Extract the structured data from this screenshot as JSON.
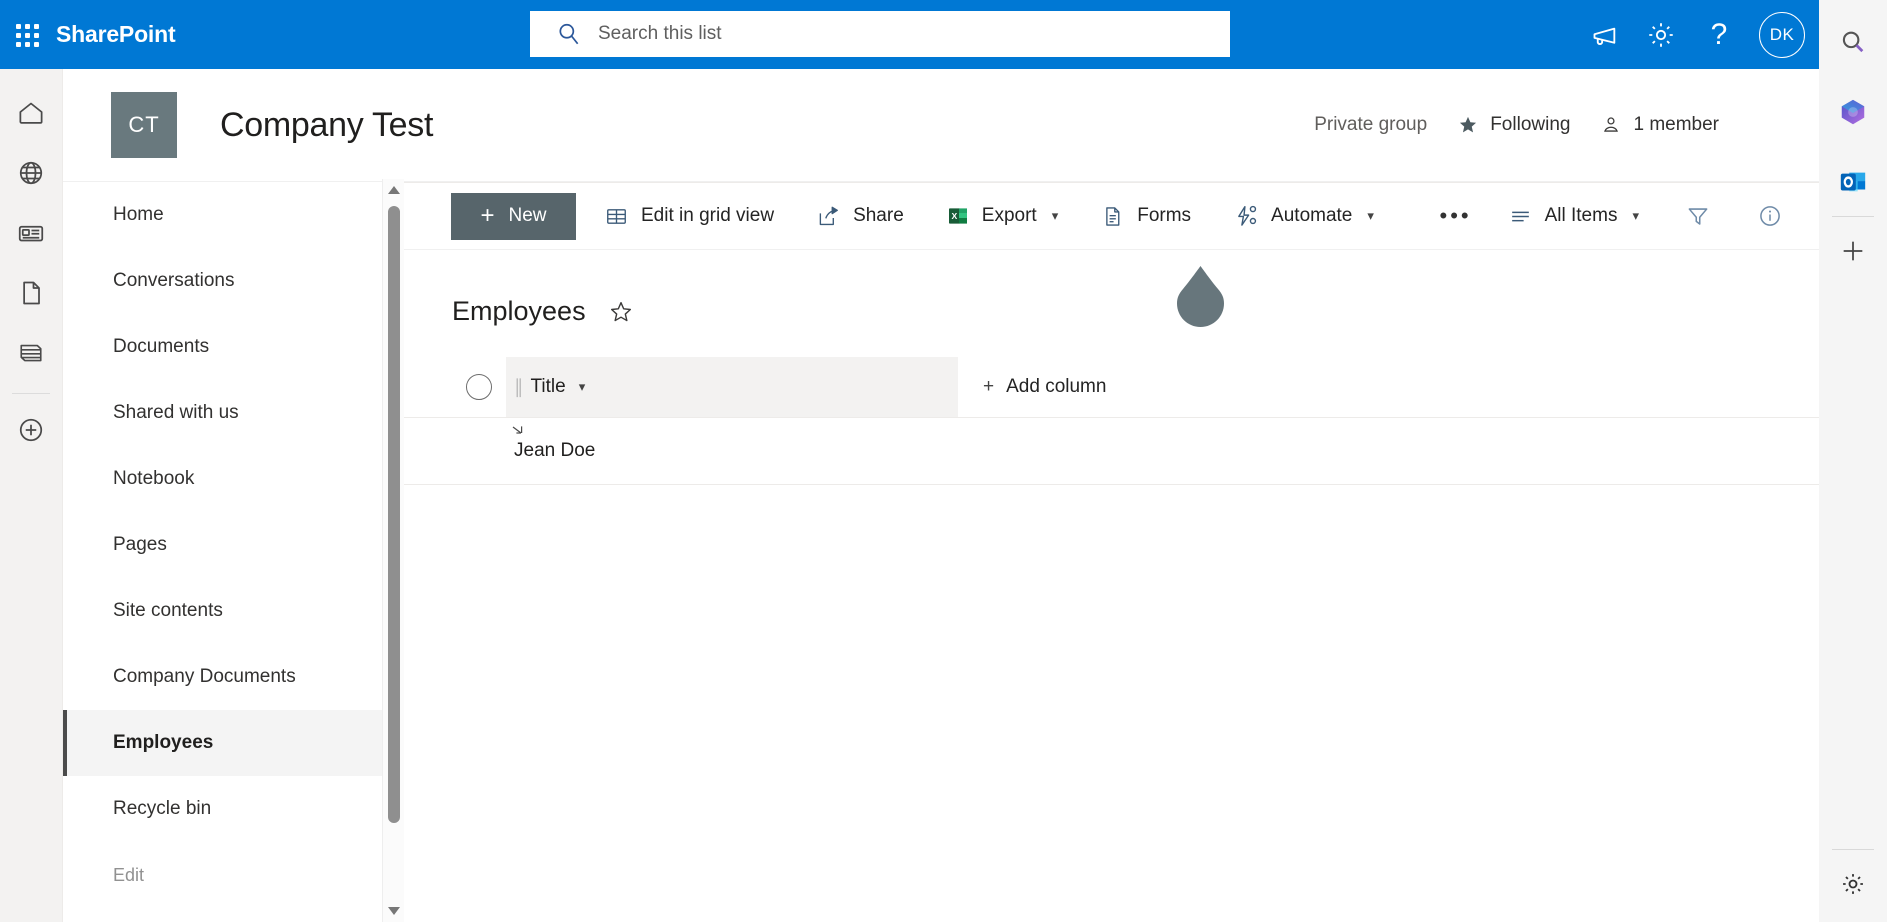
{
  "suite": {
    "brand": "SharePoint",
    "waffle_icon": "app-launcher-icon",
    "search": {
      "placeholder": "Search this list",
      "value": "",
      "icon": "search-icon"
    },
    "icons": [
      {
        "name": "megaphone-icon",
        "label": ""
      },
      {
        "name": "gear-icon",
        "label": ""
      },
      {
        "name": "help-icon",
        "label": "?"
      }
    ],
    "avatar": {
      "initials": "DK"
    }
  },
  "edge_sidebar": {
    "items": [
      {
        "name": "search-icon",
        "label": "Search"
      },
      {
        "name": "microsoft365-icon",
        "label": "Microsoft 365"
      },
      {
        "name": "outlook-icon",
        "label": "Outlook"
      },
      {
        "name": "add-icon",
        "label": "+"
      }
    ],
    "bottom": {
      "name": "settings-gear-icon",
      "label": "Settings"
    }
  },
  "app_rail": {
    "items": [
      {
        "name": "home-icon",
        "label": "Home"
      },
      {
        "name": "globe-icon",
        "label": "My sites"
      },
      {
        "name": "news-icon",
        "label": "News"
      },
      {
        "name": "file-icon",
        "label": "Files"
      },
      {
        "name": "lists-icon",
        "label": "Lists"
      },
      {
        "name": "create-icon",
        "label": "Create"
      }
    ]
  },
  "site": {
    "logo_initials": "CT",
    "title": "Company Test",
    "privacy": "Private group",
    "following": "Following",
    "members": "1 member"
  },
  "command_bar": {
    "new_label": "New",
    "commands": [
      {
        "label": "Edit in grid view",
        "icon": "grid-icon",
        "caret": false
      },
      {
        "label": "Share",
        "icon": "share-icon",
        "caret": false
      },
      {
        "label": "Export",
        "icon": "excel-icon",
        "caret": true
      },
      {
        "label": "Forms",
        "icon": "form-icon",
        "caret": false
      },
      {
        "label": "Automate",
        "icon": "automate-icon",
        "caret": true
      }
    ],
    "overflow_label": "•••",
    "view_label": "All Items",
    "filter_icon": "filter-funnel-icon",
    "info_icon": "info-icon"
  },
  "left_nav": {
    "items": [
      {
        "label": "Home",
        "selected": false
      },
      {
        "label": "Conversations",
        "selected": false
      },
      {
        "label": "Documents",
        "selected": false
      },
      {
        "label": "Shared with us",
        "selected": false
      },
      {
        "label": "Notebook",
        "selected": false
      },
      {
        "label": "Pages",
        "selected": false
      },
      {
        "label": "Site contents",
        "selected": false
      },
      {
        "label": "Company Documents",
        "selected": false
      },
      {
        "label": "Employees",
        "selected": true
      },
      {
        "label": "Recycle bin",
        "selected": false
      }
    ],
    "edit_label": "Edit"
  },
  "list": {
    "title": "Employees",
    "favorite_icon": "star-outline-icon",
    "add_column_label": "Add column",
    "columns": [
      {
        "label": "Title"
      }
    ],
    "rows": [
      {
        "Title": "Jean Doe"
      }
    ]
  },
  "colors": {
    "suite_blue": "#0078d4",
    "site_logo": "#69797e",
    "new_button": "#57656b",
    "selected_nav": "#f4f4f4",
    "teardrop": "#67767c"
  }
}
